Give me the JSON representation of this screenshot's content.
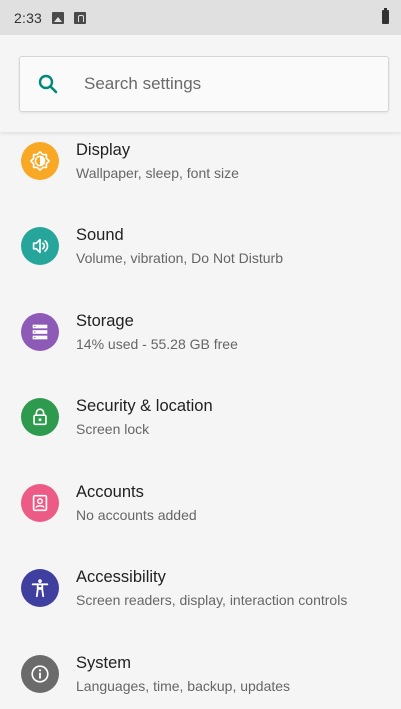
{
  "status_bar": {
    "time": "2:33"
  },
  "search": {
    "placeholder": "Search settings"
  },
  "settings": [
    {
      "title": "Display",
      "summary": "Wallpaper, sleep, font size",
      "icon": "display-icon",
      "color": "#f9a825"
    },
    {
      "title": "Sound",
      "summary": "Volume, vibration, Do Not Disturb",
      "icon": "sound-icon",
      "color": "#26a69a"
    },
    {
      "title": "Storage",
      "summary": "14% used - 55.28 GB free",
      "icon": "storage-icon",
      "color": "#8e5ab8"
    },
    {
      "title": "Security & location",
      "summary": "Screen lock",
      "icon": "lock-icon",
      "color": "#2e9a4e"
    },
    {
      "title": "Accounts",
      "summary": "No accounts added",
      "icon": "account-icon",
      "color": "#ec5a86"
    },
    {
      "title": "Accessibility",
      "summary": "Screen readers, display, interaction controls",
      "icon": "accessibility-icon",
      "color": "#3f3fa0"
    },
    {
      "title": "System",
      "summary": "Languages, time, backup, updates",
      "icon": "info-icon",
      "color": "#6b6b6b"
    }
  ],
  "colors": {
    "accent": "#00897b",
    "background": "#f5f5f5",
    "status_bar": "#e0e0e0"
  }
}
